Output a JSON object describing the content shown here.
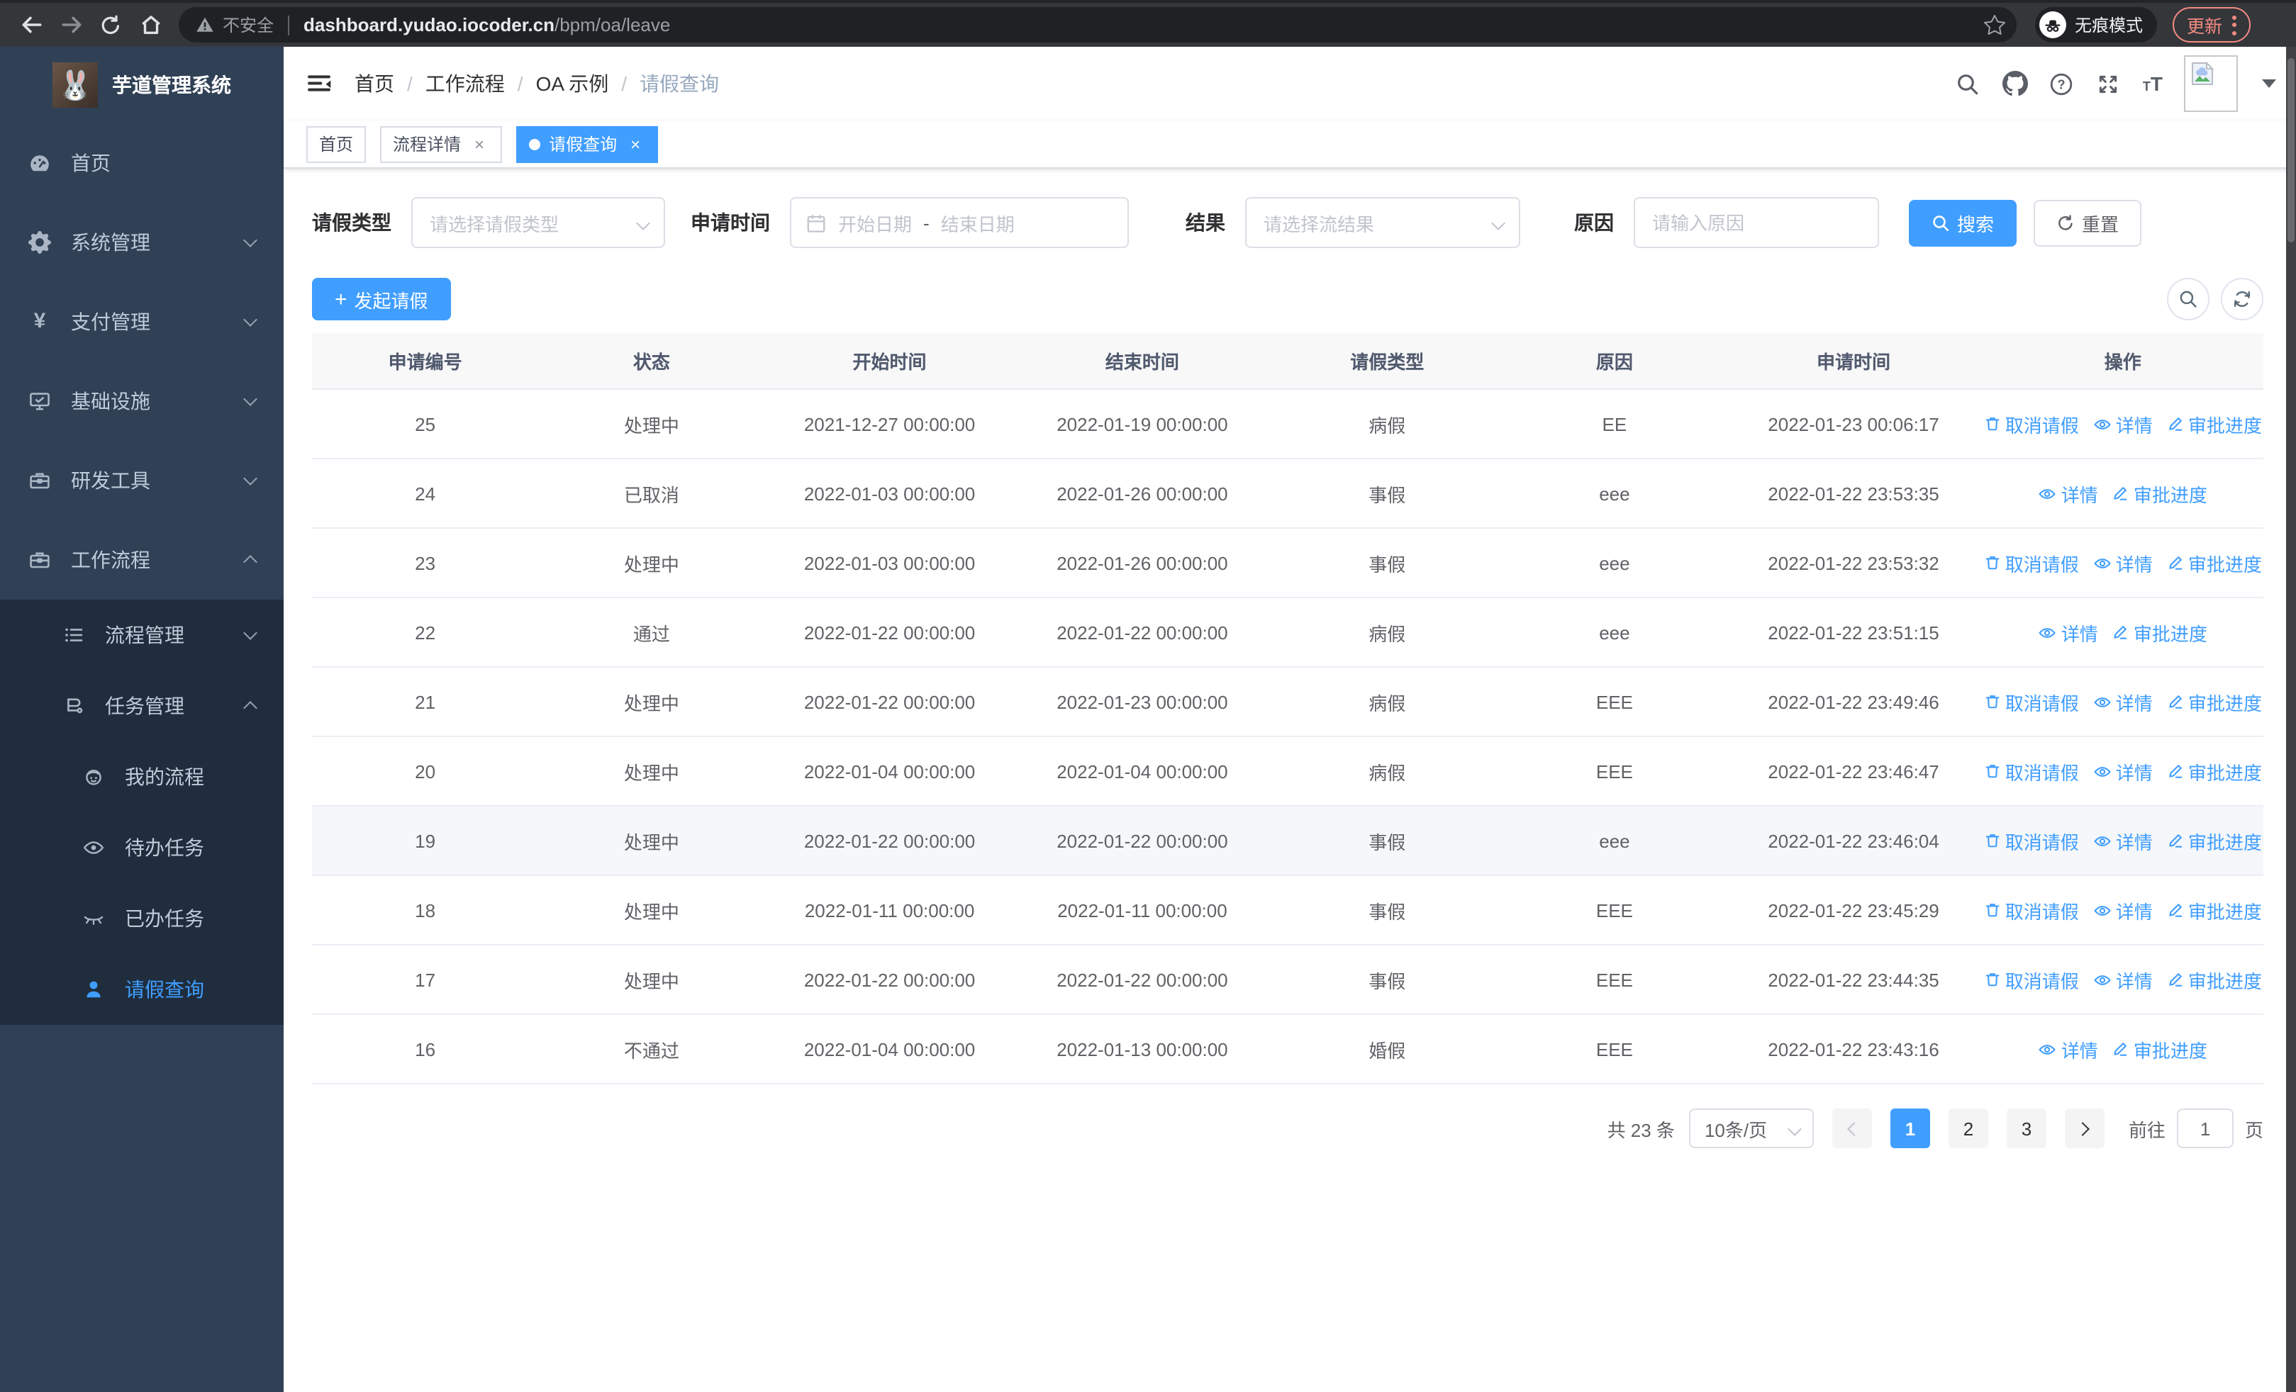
{
  "browser": {
    "security_label": "不安全",
    "url_host": "dashboard.yudao.iocoder.cn",
    "url_path": "/bpm/oa/leave",
    "incognito_label": "无痕模式",
    "update_label": "更新"
  },
  "colors": {
    "accent_blue": "#409eff",
    "sidebar_bg": "#304156",
    "submenu_bg": "#1f2d3d",
    "sidebar_text": "#bfcbd9",
    "chrome_bg": "#35363a",
    "chrome_pill_bg": "#202124",
    "update_salmon": "#f28b82",
    "table_header_bg": "#f8f8f9",
    "row_highlight": "#f5f7fa"
  },
  "sidebar": {
    "title": "芋道管理系统",
    "items": [
      {
        "label": "首页"
      },
      {
        "label": "系统管理"
      },
      {
        "label": "支付管理"
      },
      {
        "label": "基础设施"
      },
      {
        "label": "研发工具"
      },
      {
        "label": "工作流程"
      },
      {
        "label": "流程管理"
      },
      {
        "label": "任务管理"
      },
      {
        "label": "我的流程"
      },
      {
        "label": "待办任务"
      },
      {
        "label": "已办任务"
      },
      {
        "label": "请假查询"
      }
    ]
  },
  "header": {
    "breadcrumb": [
      "首页",
      "工作流程",
      "OA 示例",
      "请假查询"
    ]
  },
  "tags": [
    {
      "label": "首页"
    },
    {
      "label": "流程详情"
    },
    {
      "label": "请假查询"
    }
  ],
  "filters": {
    "leave_type_label": "请假类型",
    "leave_type_placeholder": "请选择请假类型",
    "apply_time_label": "申请时间",
    "start_date_placeholder": "开始日期",
    "range_separator": "-",
    "end_date_placeholder": "结束日期",
    "result_label": "结果",
    "result_placeholder": "请选择流结果",
    "reason_label": "原因",
    "reason_placeholder": "请输入原因",
    "search_label": "搜索",
    "reset_label": "重置"
  },
  "toolbar": {
    "create_label": "发起请假"
  },
  "table": {
    "columns": [
      "申请编号",
      "状态",
      "开始时间",
      "结束时间",
      "请假类型",
      "原因",
      "申请时间",
      "操作"
    ],
    "action_labels": {
      "cancel": "取消请假",
      "detail": "详情",
      "progress": "审批进度"
    },
    "rows": [
      {
        "id": "25",
        "status": "处理中",
        "start": "2021-12-27 00:00:00",
        "end": "2022-01-19 00:00:00",
        "type": "病假",
        "reason": "EE",
        "applied": "2022-01-23 00:06:17",
        "actions": [
          "cancel",
          "detail",
          "progress"
        ],
        "highlight": false
      },
      {
        "id": "24",
        "status": "已取消",
        "start": "2022-01-03 00:00:00",
        "end": "2022-01-26 00:00:00",
        "type": "事假",
        "reason": "eee",
        "applied": "2022-01-22 23:53:35",
        "actions": [
          "detail",
          "progress"
        ],
        "highlight": false
      },
      {
        "id": "23",
        "status": "处理中",
        "start": "2022-01-03 00:00:00",
        "end": "2022-01-26 00:00:00",
        "type": "事假",
        "reason": "eee",
        "applied": "2022-01-22 23:53:32",
        "actions": [
          "cancel",
          "detail",
          "progress"
        ],
        "highlight": false
      },
      {
        "id": "22",
        "status": "通过",
        "start": "2022-01-22 00:00:00",
        "end": "2022-01-22 00:00:00",
        "type": "病假",
        "reason": "eee",
        "applied": "2022-01-22 23:51:15",
        "actions": [
          "detail",
          "progress"
        ],
        "highlight": false
      },
      {
        "id": "21",
        "status": "处理中",
        "start": "2022-01-22 00:00:00",
        "end": "2022-01-23 00:00:00",
        "type": "病假",
        "reason": "EEE",
        "applied": "2022-01-22 23:49:46",
        "actions": [
          "cancel",
          "detail",
          "progress"
        ],
        "highlight": false
      },
      {
        "id": "20",
        "status": "处理中",
        "start": "2022-01-04 00:00:00",
        "end": "2022-01-04 00:00:00",
        "type": "病假",
        "reason": "EEE",
        "applied": "2022-01-22 23:46:47",
        "actions": [
          "cancel",
          "detail",
          "progress"
        ],
        "highlight": false
      },
      {
        "id": "19",
        "status": "处理中",
        "start": "2022-01-22 00:00:00",
        "end": "2022-01-22 00:00:00",
        "type": "事假",
        "reason": "eee",
        "applied": "2022-01-22 23:46:04",
        "actions": [
          "cancel",
          "detail",
          "progress"
        ],
        "highlight": true
      },
      {
        "id": "18",
        "status": "处理中",
        "start": "2022-01-11 00:00:00",
        "end": "2022-01-11 00:00:00",
        "type": "事假",
        "reason": "EEE",
        "applied": "2022-01-22 23:45:29",
        "actions": [
          "cancel",
          "detail",
          "progress"
        ],
        "highlight": false
      },
      {
        "id": "17",
        "status": "处理中",
        "start": "2022-01-22 00:00:00",
        "end": "2022-01-22 00:00:00",
        "type": "事假",
        "reason": "EEE",
        "applied": "2022-01-22 23:44:35",
        "actions": [
          "cancel",
          "detail",
          "progress"
        ],
        "highlight": false
      },
      {
        "id": "16",
        "status": "不通过",
        "start": "2022-01-04 00:00:00",
        "end": "2022-01-13 00:00:00",
        "type": "婚假",
        "reason": "EEE",
        "applied": "2022-01-22 23:43:16",
        "actions": [
          "detail",
          "progress"
        ],
        "highlight": false
      }
    ]
  },
  "pagination": {
    "total_label": "共 23 条",
    "page_size": "10条/页",
    "pages": [
      "1",
      "2",
      "3"
    ],
    "active_page": "1",
    "goto_label": "前往",
    "goto_value": "1",
    "unit_label": "页"
  }
}
